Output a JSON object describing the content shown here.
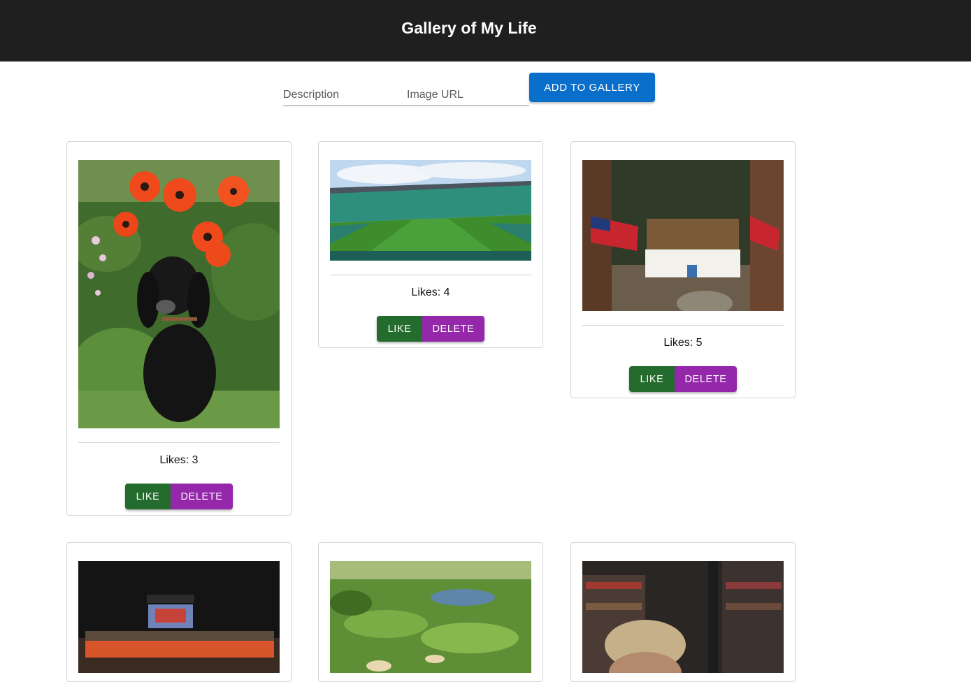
{
  "header": {
    "title": "Gallery of My Life",
    "background": "#1f1f1f"
  },
  "form": {
    "description_placeholder": "Description",
    "description_value": "",
    "url_placeholder": "Image URL",
    "url_value": "",
    "add_button_label": "ADD TO GALLERY",
    "add_button_color": "#0a6fcb"
  },
  "buttons": {
    "like_label": "LIKE",
    "like_color": "#246b2e",
    "delete_label": "DELETE",
    "delete_color": "#9427aa"
  },
  "gallery": [
    {
      "image": "dog-in-poppies-photo",
      "likes_label": "Likes: 3"
    },
    {
      "image": "football-stadium-photo",
      "likes_label": "Likes: 4"
    },
    {
      "image": "two-rivers-sign-photo",
      "likes_label": "Likes: 5"
    },
    {
      "image": "team-champions-night-photo",
      "likes_label": ""
    },
    {
      "image": "golf-course-aerial-photo",
      "likes_label": ""
    },
    {
      "image": "bookstore-person-photo",
      "likes_label": ""
    }
  ]
}
